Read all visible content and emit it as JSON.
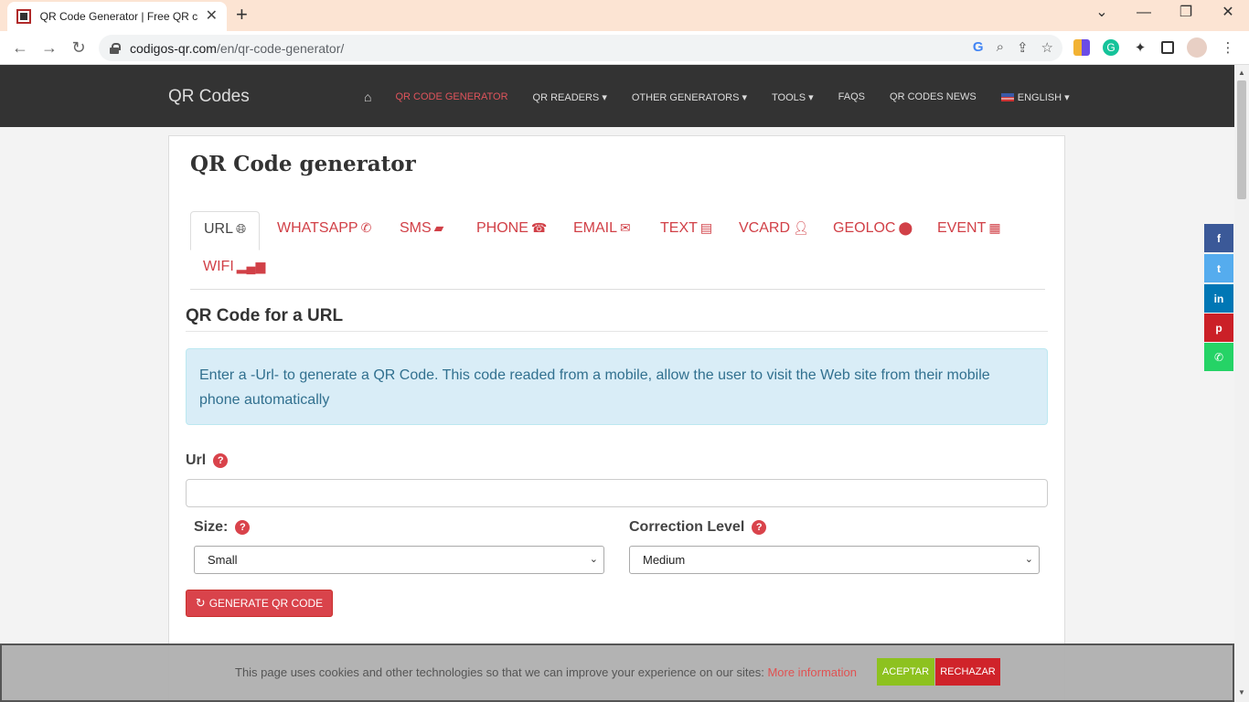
{
  "browser": {
    "tab_title": "QR Code Generator | Free QR cre",
    "url_host": "codigos-qr.com",
    "url_path": "/en/qr-code-generator/"
  },
  "site": {
    "brand": "QR Codes",
    "menu": [
      {
        "label": "QR CODE GENERATOR",
        "active": true
      },
      {
        "label": "QR READERS ▾"
      },
      {
        "label": "OTHER GENERATORS ▾"
      },
      {
        "label": "TOOLS ▾"
      },
      {
        "label": "FAQS"
      },
      {
        "label": "QR CODES NEWS"
      },
      {
        "label": "ENGLISH ▾"
      }
    ]
  },
  "main": {
    "title": "QR Code generator",
    "tabs": [
      {
        "label": "URL",
        "icon": "globe-icon"
      },
      {
        "label": "WHATSAPP",
        "icon": "whatsapp-icon"
      },
      {
        "label": "SMS",
        "icon": "comment-icon"
      },
      {
        "label": "PHONE",
        "icon": "phone-icon"
      },
      {
        "label": "EMAIL",
        "icon": "envelope-icon"
      },
      {
        "label": "TEXT",
        "icon": "document-icon"
      },
      {
        "label": "VCARD",
        "icon": "user-icon"
      },
      {
        "label": "GEOLOC",
        "icon": "map-marker-icon"
      },
      {
        "label": "EVENT",
        "icon": "calendar-icon"
      },
      {
        "label": "WIFI",
        "icon": "signal-icon"
      }
    ],
    "section_title": "QR Code for a URL",
    "info_text": "Enter a -Url- to generate a QR Code. This code readed from a mobile, allow the user to visit the Web site from their mobile phone automatically",
    "url_label": "Url",
    "url_value": "",
    "size_label": "Size:",
    "size_value": "Small",
    "correction_label": "Correction Level",
    "correction_value": "Medium",
    "generate_label": "GENERATE QR CODE"
  },
  "cookie": {
    "text": "This page uses cookies and other technologies so that we can improve your experience on our sites: ",
    "link": "More information",
    "accept": "ACEPTAR",
    "reject": "RECHAZAR"
  },
  "social": [
    {
      "name": "facebook",
      "glyph": "f",
      "color": "#3b5998"
    },
    {
      "name": "twitter",
      "glyph": "t",
      "color": "#55acee"
    },
    {
      "name": "linkedin",
      "glyph": "in",
      "color": "#0077b5"
    },
    {
      "name": "pinterest",
      "glyph": "p",
      "color": "#cb2027"
    },
    {
      "name": "whatsapp",
      "glyph": "✆",
      "color": "#25d366"
    }
  ]
}
